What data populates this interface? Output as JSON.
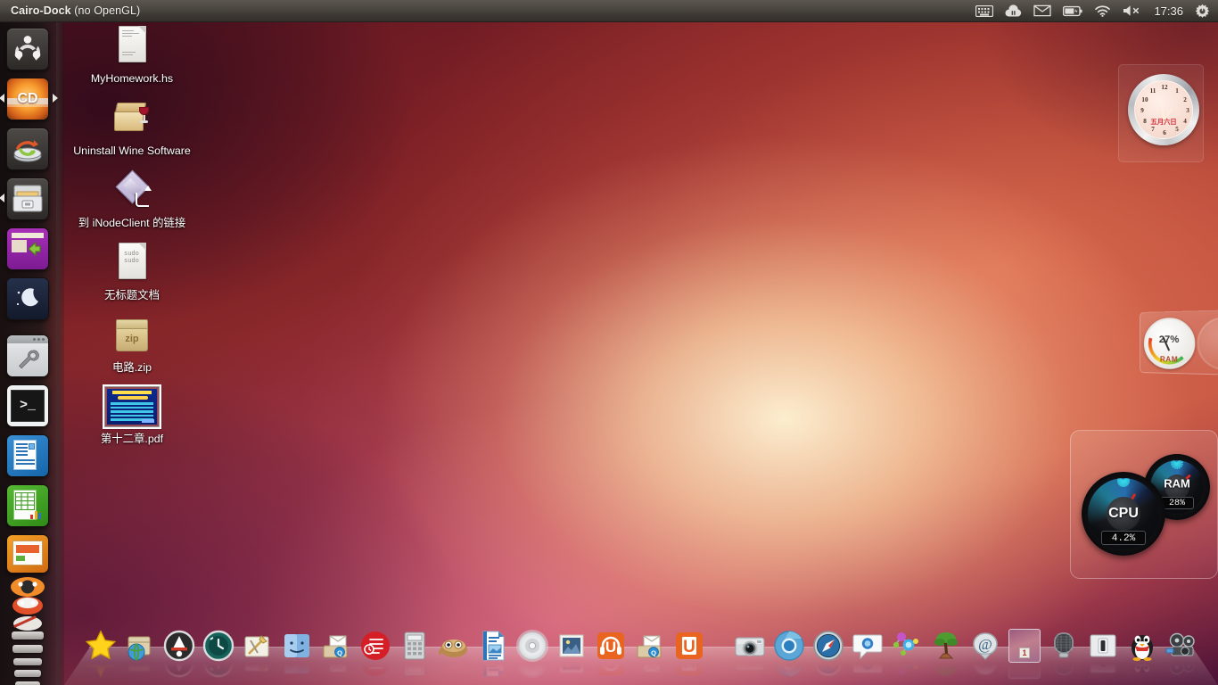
{
  "window": {
    "title_main": "Cairo-Dock",
    "title_sub": " (no OpenGL)"
  },
  "tray": {
    "items": [
      {
        "name": "keyboard-indicator-icon",
        "glyph": "keyboard"
      },
      {
        "name": "sync-indicator-icon",
        "glyph": "cloud-pause"
      },
      {
        "name": "messaging-indicator-icon",
        "glyph": "envelope"
      },
      {
        "name": "battery-indicator-icon",
        "glyph": "battery"
      },
      {
        "name": "network-wifi-indicator-icon",
        "glyph": "wifi"
      },
      {
        "name": "volume-indicator-icon",
        "glyph": "speaker-muted"
      }
    ],
    "clock": "17:36",
    "session_icon": "gear-power-icon"
  },
  "desktop_icons": [
    {
      "label": "MyHomework.hs",
      "type": "document",
      "selected": false
    },
    {
      "label": "Uninstall Wine Software",
      "type": "wine-box",
      "selected": false
    },
    {
      "label": "到 iNodeClient 的链接",
      "type": "link",
      "selected": false
    },
    {
      "label": "无标题文档",
      "type": "document-sudo",
      "selected": false
    },
    {
      "label": "电路.zip",
      "type": "archive",
      "zip_label": "zip",
      "selected": false
    },
    {
      "label": "第十二章.pdf",
      "type": "pdf-thumbnail",
      "selected": true
    }
  ],
  "left_dock": {
    "items": [
      {
        "name": "dock-item-ubuntu-dash",
        "label": "Ubuntu Dash",
        "arrow": "none"
      },
      {
        "name": "dock-item-cairo-dock",
        "label": "Cairo-Dock",
        "arrow": "both"
      },
      {
        "name": "dock-item-backup",
        "label": "Backup Tool",
        "arrow": "none"
      },
      {
        "name": "dock-item-file-manager",
        "label": "File Manager",
        "arrow": "left"
      },
      {
        "name": "dock-item-window-switcher",
        "label": "Window Switcher",
        "arrow": "none"
      },
      {
        "name": "dock-item-screensaver",
        "label": "Screensaver",
        "arrow": "none"
      },
      {
        "name": "dock-item-system-settings",
        "label": "System Settings",
        "arrow": "none"
      },
      {
        "name": "dock-item-terminal",
        "label": "Terminal",
        "arrow": "none"
      },
      {
        "name": "dock-item-libreoffice-writer",
        "label": "LibreOffice Writer",
        "arrow": "none"
      },
      {
        "name": "dock-item-libreoffice-calc",
        "label": "LibreOffice Calc",
        "arrow": "none"
      },
      {
        "name": "dock-item-libreoffice-impress",
        "label": "LibreOffice Impress",
        "arrow": "none"
      },
      {
        "name": "dock-item-ubuntu-software",
        "label": "Ubuntu Software Center",
        "arrow": "none"
      },
      {
        "name": "dock-item-gimp",
        "label": "GIMP",
        "arrow": "none"
      }
    ]
  },
  "bottom_dock": {
    "items": [
      {
        "name": "dock-star-icon",
        "label": "Favorites"
      },
      {
        "name": "dock-package-globe-icon",
        "label": "Package Web"
      },
      {
        "name": "dock-apps-icon",
        "label": "Applications"
      },
      {
        "name": "dock-history-icon",
        "label": "Recent"
      },
      {
        "name": "dock-accessories-icon",
        "label": "Accessories"
      },
      {
        "name": "dock-finder-icon",
        "label": "File Browser"
      },
      {
        "name": "dock-mail-box-icon",
        "label": "Mailbox"
      },
      {
        "name": "dock-red-note-icon",
        "label": "Notes"
      },
      {
        "name": "dock-calculator-icon",
        "label": "Calculator"
      },
      {
        "name": "dock-gimp-icon",
        "label": "GIMP"
      },
      {
        "name": "dock-document-icon",
        "label": "LibreOffice"
      },
      {
        "name": "dock-disc-icon",
        "label": "Disc Burner"
      },
      {
        "name": "dock-stamp-mail-icon",
        "label": "Mail"
      },
      {
        "name": "dock-music-u-icon",
        "label": "Ubuntu One Music"
      },
      {
        "name": "dock-mailbox-q-icon",
        "label": "QQ Mail"
      },
      {
        "name": "dock-ubuntu-one-icon",
        "label": "Ubuntu One"
      },
      {
        "name": "dock-camera-icon",
        "label": "Camera"
      },
      {
        "name": "dock-chromium-icon",
        "label": "Chromium"
      },
      {
        "name": "dock-compass-browser-icon",
        "label": "Web Browser"
      },
      {
        "name": "dock-chat-bubble-icon",
        "label": "Messaging"
      },
      {
        "name": "dock-network-nodes-icon",
        "label": "Network"
      },
      {
        "name": "dock-bonsai-icon",
        "label": "Bonsai"
      },
      {
        "name": "dock-at-mail-icon",
        "label": "Email"
      },
      {
        "name": "dock-workspace-switcher-icon",
        "label": "Workspace",
        "badge": "1"
      },
      {
        "name": "dock-microphone-icon",
        "label": "Sound Recorder"
      },
      {
        "name": "dock-light-switch-icon",
        "label": "Switch"
      },
      {
        "name": "dock-qq-penguin-icon",
        "label": "QQ"
      },
      {
        "name": "dock-movie-projector-icon",
        "label": "Movie Player"
      }
    ]
  },
  "desklets": {
    "clock": {
      "name": "clock-desklet",
      "numerals": [
        "12",
        "1",
        "2",
        "3",
        "4",
        "5",
        "6",
        "7",
        "8",
        "9",
        "10",
        "11"
      ],
      "date_text": "五月六日"
    },
    "ram_gauge": {
      "name": "ram-gauge-desklet",
      "value": "27%",
      "label": "RAM"
    },
    "system_monitor": {
      "name": "system-monitor-desklet",
      "cpu": {
        "label": "CPU",
        "value": "4.2%"
      },
      "ram": {
        "label": "RAM",
        "value": "28%"
      }
    }
  },
  "colors": {
    "panel_bg": "#4a4540",
    "accent_orange": "#e7784f",
    "wallpaper_deep_red": "#7d2026",
    "wallpaper_highlight": "#f7dcb2",
    "gauge_cyan": "#35d7e8",
    "needle_red": "#d42a20"
  }
}
